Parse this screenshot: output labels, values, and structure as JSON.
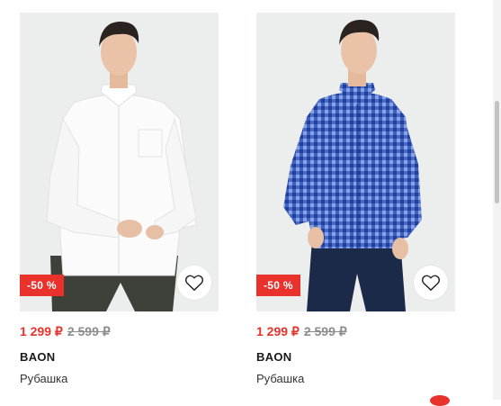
{
  "products": [
    {
      "discount_badge": "-50 %",
      "price_current": "1 299 ₽",
      "price_old": "2 599 ₽",
      "brand": "BAON",
      "category": "Рубашка",
      "shirt_color": "#fbfbfb",
      "pants_color": "#3d413a",
      "favorite_icon": "heart-icon"
    },
    {
      "discount_badge": "-50 %",
      "price_current": "1 299 ₽",
      "price_old": "2 599 ₽",
      "brand": "BAON",
      "category": "Рубашка",
      "shirt_color": "#3e62c4",
      "pants_color": "#1c2a4a",
      "favorite_icon": "heart-icon"
    }
  ],
  "colors": {
    "accent": "#e8322b",
    "old_price": "#8c8c8c",
    "photo_background": "#eceded"
  }
}
